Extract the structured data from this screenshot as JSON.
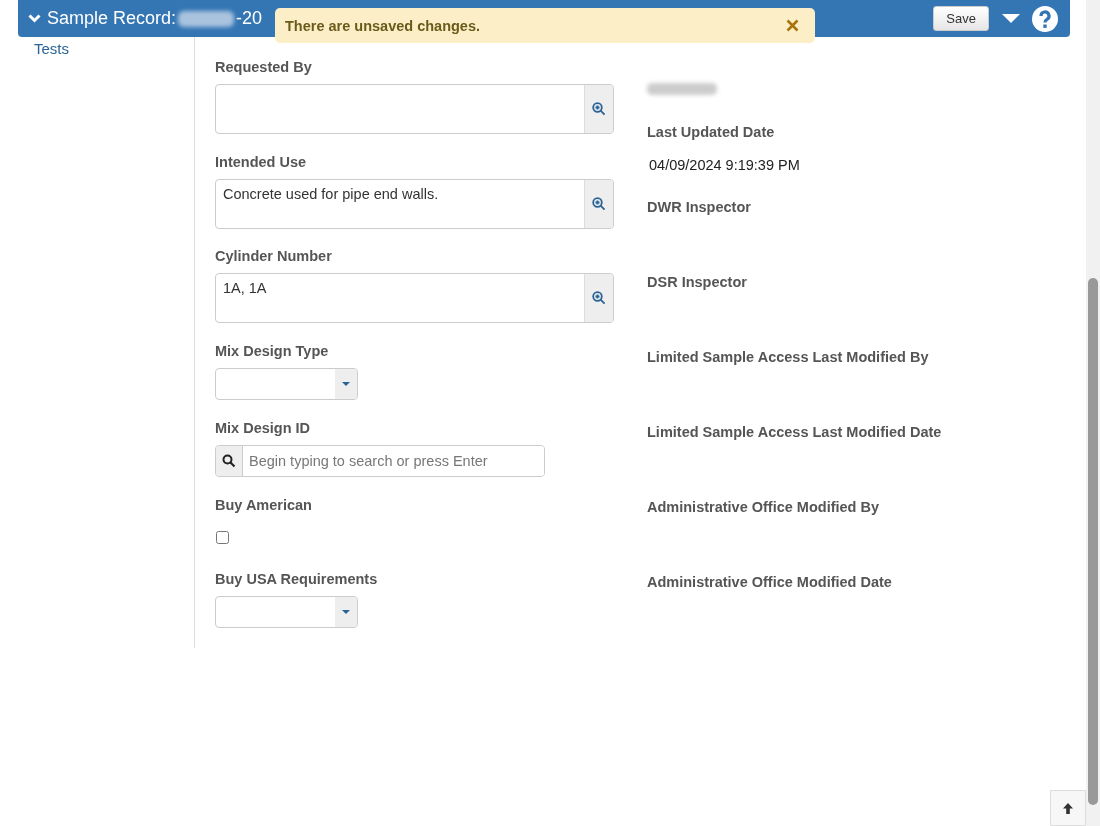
{
  "header": {
    "title": "Sample Record:",
    "title_suffix": "-20",
    "save_button": "Save"
  },
  "toast": {
    "message": "There are unsaved changes."
  },
  "sidebar": {
    "items": [
      {
        "label": "Tests"
      }
    ]
  },
  "left_fields": [
    {
      "kind": "lookup",
      "label": "Requested By"
    },
    {
      "kind": "lookup",
      "label": "Intended Use",
      "value": "Concrete used for pipe end walls."
    },
    {
      "kind": "lookup",
      "label": "Cylinder Number",
      "value": "1A, 1A"
    },
    {
      "kind": "select",
      "label": "Mix Design Type"
    },
    {
      "kind": "search",
      "label": "Mix Design ID",
      "placeholder": "Begin typing to search or press Enter"
    },
    {
      "kind": "checkbox",
      "label": "Buy American",
      "checked": false
    },
    {
      "kind": "select",
      "label": "Buy USA Requirements"
    }
  ],
  "right_fields": [
    {
      "kind": "redacted"
    },
    {
      "kind": "text",
      "label": "Last Updated Date",
      "value": "04/09/2024 9:19:39 PM"
    },
    {
      "kind": "text",
      "label": "DWR Inspector"
    },
    {
      "kind": "text",
      "label": "DSR Inspector"
    },
    {
      "kind": "text",
      "label": "Limited Sample Access Last Modified By"
    },
    {
      "kind": "text",
      "label": "Limited Sample Access Last Modified Date"
    },
    {
      "kind": "text",
      "label": "Administrative Office Modified By"
    },
    {
      "kind": "text",
      "label": "Administrative Office Modified Date"
    }
  ]
}
